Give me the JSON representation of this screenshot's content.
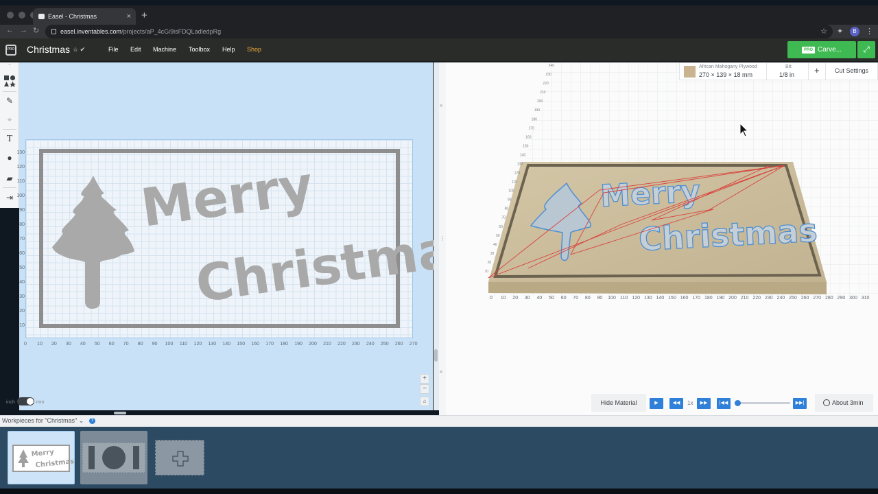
{
  "browser": {
    "tab_title": "Easel - Christmas",
    "url_host": "easel.inventables.com",
    "url_path": "/projects/aP_4cGi9isFDQLadledpRg",
    "profile_initial": "B"
  },
  "header": {
    "logo_text": "PRO",
    "project_title": "Christmas",
    "menus": [
      "File",
      "Edit",
      "Machine",
      "Toolbox",
      "Help",
      "Shop"
    ],
    "carve_badge": "PRO",
    "carve_label": "Carve...",
    "colors": {
      "carve": "#3fb951",
      "shop": "#f0a93c",
      "accent": "#2f80d8"
    }
  },
  "toolbar": {
    "icons": [
      "shapes-icon",
      "pen-icon",
      "target-icon",
      "text-icon",
      "apple-icon",
      "box-icon",
      "import-icon"
    ],
    "text_tool": "T"
  },
  "design": {
    "x_ticks": [
      "0",
      "10",
      "20",
      "30",
      "40",
      "50",
      "60",
      "70",
      "80",
      "90",
      "100",
      "110",
      "120",
      "130",
      "140",
      "150",
      "160",
      "170",
      "180",
      "190",
      "200",
      "210",
      "220",
      "230",
      "240",
      "250",
      "260",
      "270"
    ],
    "y_ticks": [
      "130",
      "120",
      "110",
      "100",
      "90",
      "80",
      "70",
      "60",
      "50",
      "40",
      "30",
      "20",
      "10"
    ],
    "text_line1": "Merry",
    "text_line2": "Christmas",
    "zoom_in": "+",
    "zoom_out": "−",
    "unit_inch": "inch",
    "unit_mm": "mm"
  },
  "preview": {
    "material_name": "African Mahogany Plywood",
    "material_dims": "270 × 139 × 18 mm",
    "bit_label": "Bit:",
    "bit_value": "1/8 in",
    "add_label": "+",
    "cut_settings": "Cut Settings",
    "hide_material": "Hide Material",
    "speed": "1x",
    "about": "About 3min",
    "x_ticks": [
      "0",
      "10",
      "20",
      "30",
      "40",
      "50",
      "60",
      "70",
      "80",
      "90",
      "100",
      "110",
      "120",
      "130",
      "140",
      "150",
      "160",
      "170",
      "180",
      "190",
      "200",
      "210",
      "220",
      "230",
      "240",
      "250",
      "260",
      "270",
      "280",
      "290",
      "300",
      "310"
    ],
    "y_ticks": [
      "240",
      "230",
      "220",
      "210",
      "200",
      "190",
      "180",
      "170",
      "160",
      "150",
      "140",
      "130",
      "120",
      "110",
      "100",
      "90",
      "80",
      "70",
      "60",
      "50",
      "40",
      "30",
      "20",
      "10"
    ],
    "text_line1": "Merry",
    "text_line2": "Christmas"
  },
  "workpieces": {
    "label": "Workpieces for \"Christmas\"",
    "help": "?",
    "thumb1_line1": "Merry",
    "thumb1_line2": "Christmas"
  }
}
